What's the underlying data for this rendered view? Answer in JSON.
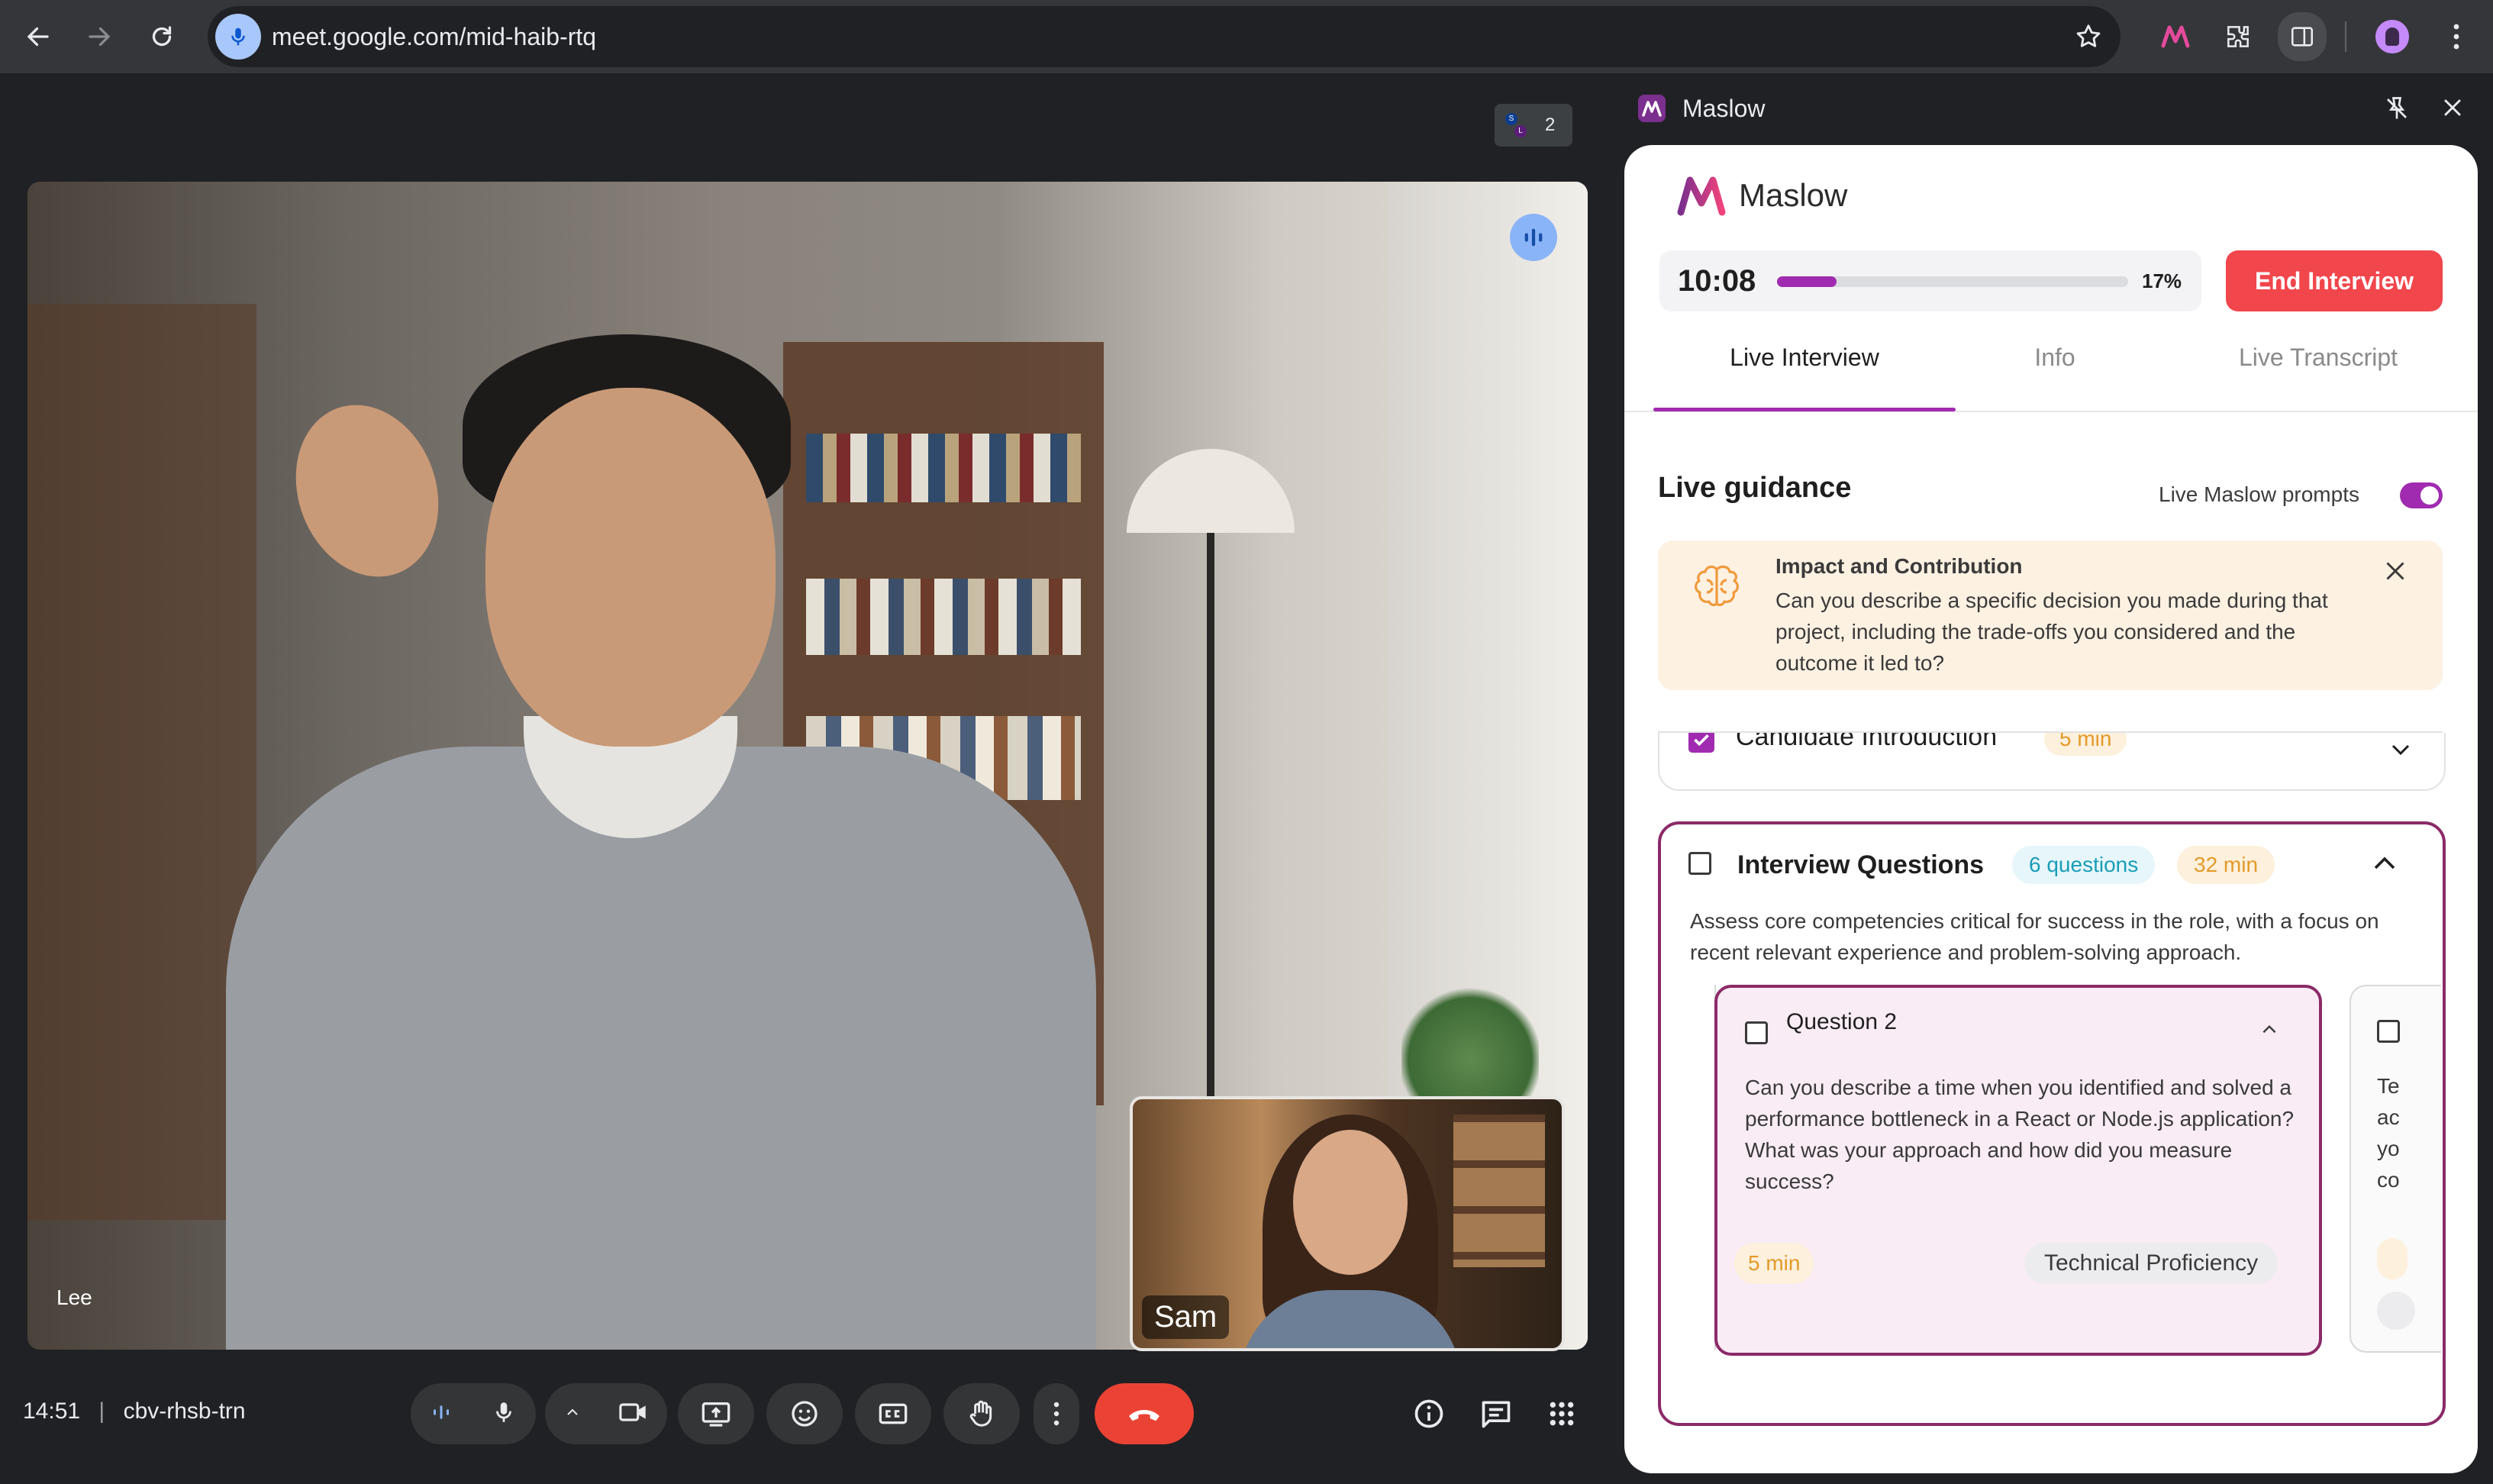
{
  "browser": {
    "url": "meet.google.com/mid-haib-rtq",
    "back_icon": "arrow-left-icon",
    "forward_icon": "arrow-right-icon",
    "reload_icon": "reload-icon"
  },
  "meet": {
    "participant_count": "2",
    "participant_initials": [
      "S",
      "L"
    ],
    "main_participant": "Lee",
    "pip_participant": "Sam",
    "time": "14:51",
    "meeting_code": "cbv-rhsb-trn",
    "controls": [
      "audio-levels",
      "microphone",
      "more-options-chevron",
      "camera",
      "present",
      "reactions",
      "captions",
      "raise-hand",
      "more",
      "end-call"
    ],
    "right_controls": [
      "info",
      "chat",
      "activities"
    ],
    "end_call_color": "#ea4335"
  },
  "panel": {
    "header_title": "Maslow",
    "brand_name": "Maslow",
    "brand_color": "#a02bb0",
    "timer": "10:08",
    "progress_fraction": 0.17,
    "progress_label": "17%",
    "end_button": "End Interview",
    "tabs": [
      {
        "label": "Live Interview",
        "active": true
      },
      {
        "label": "Info",
        "active": false
      },
      {
        "label": "Live Transcript",
        "active": false
      }
    ],
    "guidance_title": "Live guidance",
    "prompts_label": "Live Maslow prompts",
    "prompts_enabled": true,
    "hint": {
      "title": "Impact and Contribution",
      "body": "Can you describe a specific decision you made during that project, including the trade-offs you considered and the outcome it led to?"
    },
    "intro_section": {
      "title": "Candidate Introduction",
      "time": "5 min",
      "checked": true
    },
    "questions_section": {
      "title": "Interview Questions",
      "count_badge": "6 questions",
      "time_badge": "32 min",
      "description": "Assess core competencies critical for success in the role, with a focus on recent relevant experience and problem-solving approach.",
      "question": {
        "title": "Question 2",
        "body": "Can you describe a time when you identified and solved a performance bottleneck in a React or Node.js application? What was your approach and how did you measure success?",
        "time": "5 min",
        "category": "Technical Proficiency"
      },
      "next_question_partial": "Te ac yo co"
    }
  }
}
